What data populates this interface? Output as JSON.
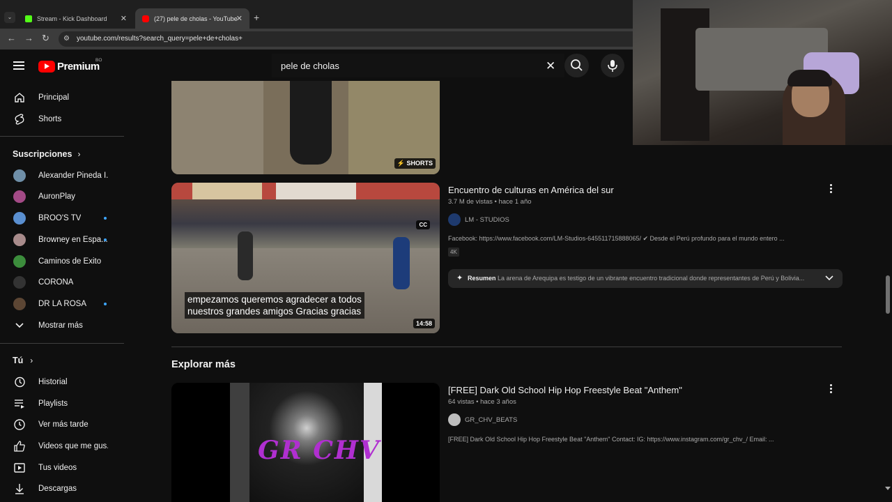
{
  "browser": {
    "tabs": [
      {
        "title": "Stream - Kick Dashboard",
        "favicon_color": "#53fc18"
      },
      {
        "title": "(27) pele de cholas - YouTube",
        "favicon_color": "#ff0000"
      }
    ],
    "url": "youtube.com/results?search_query=pele+de+cholas+"
  },
  "header": {
    "logo_text": "Premium",
    "logo_badge": "BO",
    "search_value": "pele de cholas"
  },
  "sidebar": {
    "main": [
      {
        "label": "Principal",
        "icon": "home-icon"
      },
      {
        "label": "Shorts",
        "icon": "shorts-icon"
      }
    ],
    "subscriptions_title": "Suscripciones",
    "subscriptions": [
      {
        "label": "Alexander Pineda I...",
        "color": "#6f8fa8",
        "live": false
      },
      {
        "label": "AuronPlay",
        "color": "#a34a86",
        "live": false
      },
      {
        "label": "BROO'S TV",
        "color": "#5a8fd0",
        "live": true
      },
      {
        "label": "Browney en Espa...",
        "color": "#a88b8b",
        "live": true
      },
      {
        "label": "Caminos de Éxito",
        "color": "#3c8d3c",
        "live": false
      },
      {
        "label": "CORONA",
        "color": "#333333",
        "live": false
      },
      {
        "label": "DR LA ROSA",
        "color": "#5c4634",
        "live": true
      }
    ],
    "show_more": "Mostrar más",
    "you_title": "Tú",
    "you_items": [
      {
        "label": "Historial",
        "icon": "history-icon"
      },
      {
        "label": "Playlists",
        "icon": "playlists-icon"
      },
      {
        "label": "Ver más tarde",
        "icon": "watch-later-icon"
      },
      {
        "label": "Videos que me gus...",
        "icon": "like-icon"
      },
      {
        "label": "Tus videos",
        "icon": "your-videos-icon"
      },
      {
        "label": "Descargas",
        "icon": "downloads-icon"
      }
    ]
  },
  "results": {
    "shorts_badge": "SHORTS",
    "video1": {
      "title": "Encuentro de culturas en América del sur",
      "meta": "3.7 M de vistas • hace 1 año",
      "channel": "LM - STUDIOS",
      "description": "Facebook: https://www.facebook.com/LM-Studios-645511715888065/ ✔ Desde el Perú profundo para el mundo entero ...",
      "quality_badge": "4K",
      "duration": "14:58",
      "cc_badge": "CC",
      "caption_line1": "empezamos queremos agradecer a todos",
      "caption_line2": "nuestros grandes amigos Gracias gracias",
      "summary_label": "Resumen",
      "summary_text": "La arena de Arequipa es testigo de un vibrante encuentro tradicional donde representantes de Perú y Bolivia..."
    },
    "explore_title": "Explorar más",
    "video2": {
      "title": "[FREE] Dark Old School Hip Hop Freestyle Beat \"Anthem\"",
      "meta": "64 vistas • hace 3 años",
      "channel": "GR_CHV_BEATS",
      "description": "[FREE] Dark Old School Hip Hop Freestyle Beat \"Anthem\" Contact: IG: https://www.instagram.com/gr_chv_/ Email: ...",
      "thumb_text": "GR CHV"
    }
  }
}
